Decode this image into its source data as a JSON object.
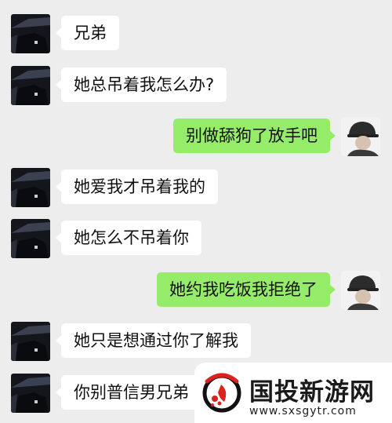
{
  "chat": {
    "messages": [
      {
        "side": "left",
        "avatar_icon": "dark-car-interior-avatar-icon",
        "text": "兄弟"
      },
      {
        "side": "left",
        "avatar_icon": "dark-car-interior-avatar-icon",
        "text": "她总吊着我怎么办?"
      },
      {
        "side": "right",
        "avatar_icon": "person-with-cap-avatar-icon",
        "text": "别做舔狗了放手吧"
      },
      {
        "side": "left",
        "avatar_icon": "dark-car-interior-avatar-icon",
        "text": "她爱我才吊着我的"
      },
      {
        "side": "left",
        "avatar_icon": "dark-car-interior-avatar-icon",
        "text": "她怎么不吊着你"
      },
      {
        "side": "right",
        "avatar_icon": "person-with-cap-avatar-icon",
        "text": "她约我吃饭我拒绝了"
      },
      {
        "side": "left",
        "avatar_icon": "dark-car-interior-avatar-icon",
        "text": "她只是想通过你了解我"
      },
      {
        "side": "left",
        "avatar_icon": "dark-car-interior-avatar-icon",
        "text": "你别普信男兄弟"
      }
    ]
  },
  "watermark": {
    "title": "国投新游网",
    "url": "www.sxsgytr.com",
    "logo_icon": "red-orbit-logo-icon"
  },
  "colors": {
    "background": "#ededed",
    "incoming_bubble": "#ffffff",
    "outgoing_bubble": "#95ec69"
  }
}
